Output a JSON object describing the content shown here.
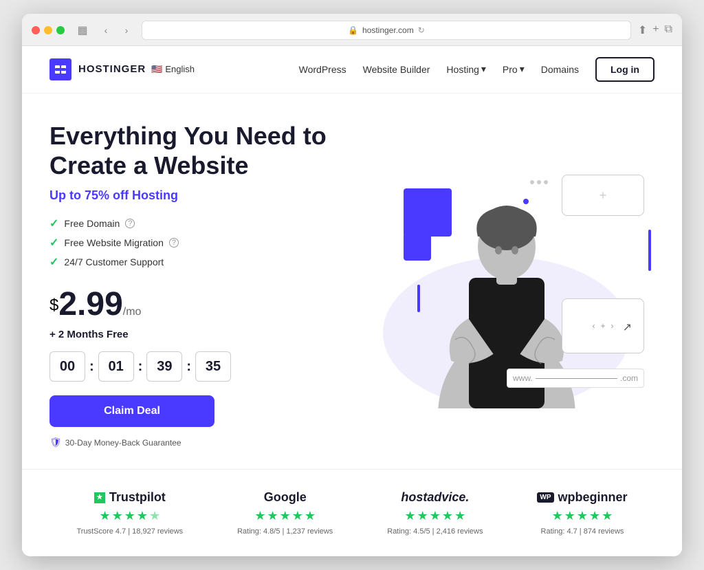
{
  "browser": {
    "url": "hostinger.com",
    "url_icon": "🔒"
  },
  "nav": {
    "logo_text": "HOSTINGER",
    "logo_letter": "H",
    "language": "English",
    "links": [
      "WordPress",
      "Website Builder",
      "Hosting",
      "Pro",
      "Domains"
    ],
    "hosting_has_dropdown": true,
    "pro_has_dropdown": true,
    "login_label": "Log in"
  },
  "hero": {
    "title": "Everything You Need to\nCreate a Website",
    "subtitle_prefix": "Up to ",
    "discount": "75%",
    "subtitle_suffix": " off Hosting",
    "features": [
      {
        "label": "Free Domain",
        "has_info": true
      },
      {
        "label": "Free Website Migration",
        "has_info": true
      },
      {
        "label": "24/7 Customer Support",
        "has_info": false
      }
    ],
    "price_dollar": "$",
    "price": "2.99",
    "price_period": "/mo",
    "price_note": "+ 2 Months Free",
    "countdown": {
      "hours": "00",
      "minutes": "01",
      "seconds_tens": "39",
      "seconds_units": "35"
    },
    "cta_label": "Claim Deal",
    "guarantee": "30-Day Money-Back Guarantee"
  },
  "reviews": [
    {
      "brand": "Trustpilot",
      "brand_type": "trustpilot",
      "full_stars": 4,
      "half_stars": 1,
      "meta": "TrustScore 4.7 | 18,927 reviews"
    },
    {
      "brand": "Google",
      "brand_type": "google",
      "full_stars": 5,
      "half_stars": 0,
      "meta": "Rating: 4.8/5 | 1,237 reviews"
    },
    {
      "brand": "hostadvice.",
      "brand_type": "italic",
      "full_stars": 5,
      "half_stars": 0,
      "meta": "Rating: 4.5/5 | 2,416 reviews"
    },
    {
      "brand": "wpbeginner",
      "brand_type": "wp",
      "full_stars": 5,
      "half_stars": 0,
      "meta": "Rating: 4.7 | 874 reviews"
    }
  ],
  "illustration": {
    "domain_www": "www.",
    "domain_com": ".com",
    "ui_dots": 3
  }
}
